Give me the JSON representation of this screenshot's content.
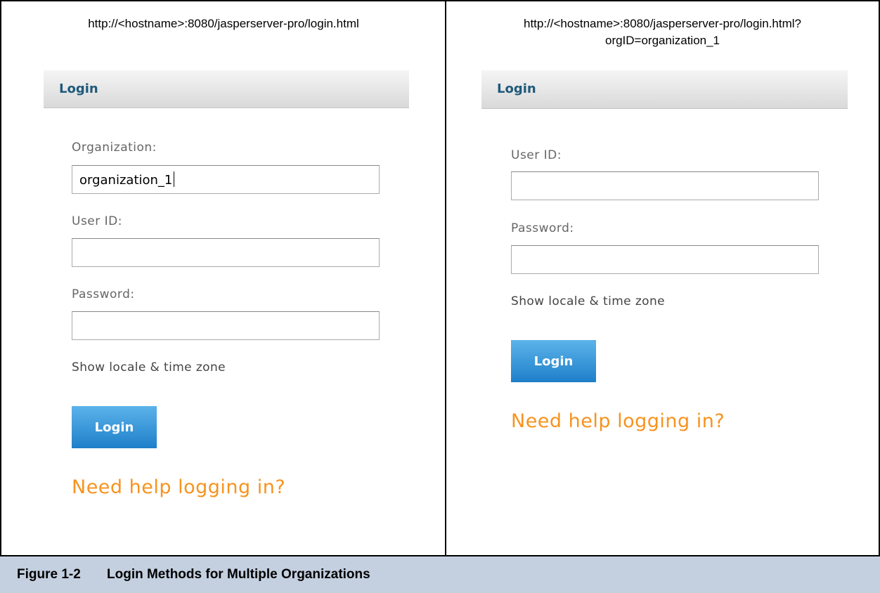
{
  "left_panel": {
    "url": "http://<hostname>:8080/jasperserver-pro/login.html",
    "header_title": "Login",
    "organization_label": "Organization:",
    "organization_value": "organization_1",
    "user_id_label": "User ID:",
    "user_id_value": "",
    "password_label": "Password:",
    "password_value": "",
    "show_locale_text": "Show locale & time zone",
    "login_button": "Login",
    "help_link": "Need help logging in?"
  },
  "right_panel": {
    "url_line1": "http://<hostname>:8080/jasperserver-pro/login.html?",
    "url_line2": "orgID=organization_1",
    "header_title": "Login",
    "user_id_label": "User ID:",
    "user_id_value": "",
    "password_label": "Password:",
    "password_value": "",
    "show_locale_text": "Show locale & time zone",
    "login_button": "Login",
    "help_link": "Need help logging in?"
  },
  "caption": {
    "figure_number": "Figure 1-2",
    "figure_title": "Login Methods for Multiple Organizations"
  },
  "colors": {
    "header_text": "#1f5a7a",
    "button_blue": "#1e7fc9",
    "help_link_orange": "#f7931e",
    "caption_bg": "#c4d0e0"
  }
}
